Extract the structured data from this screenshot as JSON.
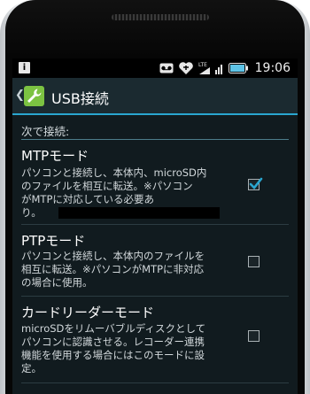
{
  "status_bar": {
    "notification_icon": "info-notification-icon",
    "icons": [
      "voicemail-icon",
      "usb-connection-icon",
      "lte-signal-icon",
      "signal-strength-icon",
      "battery-icon"
    ],
    "lte_label": "LTE",
    "time": "19:06"
  },
  "action_bar": {
    "back_caret": "❮",
    "icon": "wrench-settings-icon",
    "title": "USB接続",
    "accent_color": "#2aa6cf"
  },
  "section_header": "次で接続:",
  "options": [
    {
      "title": "MTPモード",
      "description": "パソコンと接続し、本体内、microSD内\nのファイルを相互に転送。※パソコン\nがMTPに対応している必要あ\nり。",
      "checked": true
    },
    {
      "title": "PTPモード",
      "description": "パソコンと接続し、本体内のファイルを\n相互に転送。※パソコンがMTPに非対応\nの場合に使用。",
      "checked": false
    },
    {
      "title": "カードリーダーモード",
      "description": "microSDをリムーバブルディスクとして\nパソコンに認識させる。レコーダー連携\n機能を使用する場合にはこのモードに設\n定。",
      "checked": false
    }
  ]
}
